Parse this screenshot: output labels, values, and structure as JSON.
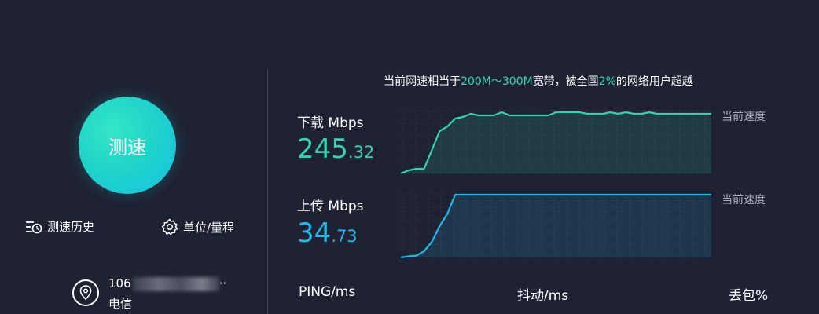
{
  "left": {
    "start_button": "测速",
    "history": "测速历史",
    "unit": "单位/量程",
    "ip_visible": "106",
    "ip_tail": "··",
    "isp_name": "电信"
  },
  "info": {
    "prefix": "当前网速相当于",
    "bandwidth": "200M～300M",
    "mid": "宽带，被全国",
    "percent": "2%",
    "suffix": "的网络用户超越"
  },
  "download": {
    "label": "下载 Mbps",
    "value_int": "245",
    "value_dec": ".32",
    "current_label": "当前速度",
    "color": "#33d2b0"
  },
  "upload": {
    "label": "上传 Mbps",
    "value_int": "34",
    "value_dec": ".73",
    "current_label": "当前速度",
    "color": "#22b8e8"
  },
  "stats": {
    "ping": "PING/ms",
    "jitter": "抖动/ms",
    "loss": "丢包%"
  },
  "chart_data": [
    {
      "type": "line",
      "series": [
        {
          "values": [
            0,
            2,
            3,
            3,
            15,
            27,
            30,
            35,
            36,
            38,
            37,
            37,
            37,
            39,
            37,
            37,
            37,
            37,
            37,
            37,
            39,
            39,
            39,
            39,
            38,
            38,
            38,
            39,
            38,
            39,
            38,
            38,
            39,
            38,
            38,
            38,
            38,
            38,
            38,
            38,
            38
          ]
        }
      ]
    },
    {
      "type": "line",
      "series": [
        {
          "values": [
            0,
            2,
            3,
            10,
            25,
            50,
            70,
            100,
            100,
            100,
            100,
            100,
            100,
            100,
            100,
            100,
            100,
            100,
            100,
            100,
            100,
            100,
            100,
            100,
            100,
            100,
            100,
            100,
            100,
            100,
            100,
            100,
            100,
            100,
            100,
            100,
            100,
            100,
            100,
            100,
            100
          ]
        }
      ]
    }
  ]
}
